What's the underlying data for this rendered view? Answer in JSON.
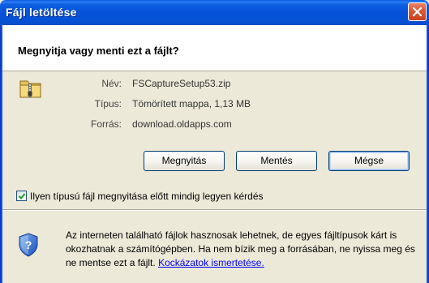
{
  "window": {
    "title": "Fájl letöltése"
  },
  "header": {
    "question": "Megnyitja vagy menti ezt a fájlt?"
  },
  "file": {
    "icon": "zip-folder-icon",
    "name_label": "Név:",
    "name_value": "FSCaptureSetup53.zip",
    "type_label": "Típus:",
    "type_value": "Tömörített mappa, 1,13 MB",
    "source_label": "Forrás:",
    "source_value": "download.oldapps.com"
  },
  "buttons": {
    "open": "Megnyitás",
    "save": "Mentés",
    "cancel": "Mégse"
  },
  "checkbox": {
    "label": "Ilyen típusú fájl megnyitása előtt mindig legyen kérdés",
    "checked": true
  },
  "warning": {
    "icon": "security-shield-icon",
    "text": "Az interneten található fájlok hasznosak lehetnek, de egyes fájltípusok kárt is okozhatnak a számítógépben. Ha nem bízik meg a forrásában, ne nyissa meg és ne mentse ezt a fájlt. ",
    "link": "Kockázatok ismertetése."
  },
  "colors": {
    "titlebar": "#0553d9",
    "dialog_bg": "#ece9d8",
    "link": "#0000ff"
  }
}
